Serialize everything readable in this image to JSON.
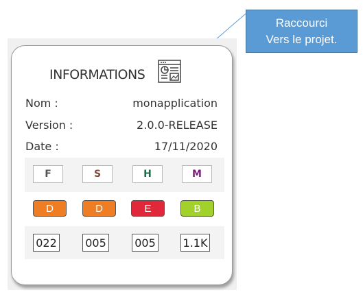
{
  "callout": {
    "line1": "Raccourci",
    "line2": "Vers le projet."
  },
  "card": {
    "title": "INFORMATIONS",
    "title_icon": "dashboard-report-icon",
    "info": [
      {
        "label": "Nom :",
        "value": "monapplication"
      },
      {
        "label": "Version :",
        "value": "2.0.0-RELEASE"
      },
      {
        "label": "Date :",
        "value": "17/11/2020"
      }
    ],
    "letters": [
      {
        "text": "F",
        "color": "#555555"
      },
      {
        "text": "S",
        "color": "#7a4a3a"
      },
      {
        "text": "H",
        "color": "#1d6b4a"
      },
      {
        "text": "M",
        "color": "#7b1a7a"
      }
    ],
    "grades": [
      {
        "text": "D",
        "color": "#ee7d24"
      },
      {
        "text": "D",
        "color": "#ee7d24"
      },
      {
        "text": "E",
        "color": "#e0283a"
      },
      {
        "text": "B",
        "color": "#a2d12b"
      }
    ],
    "counts": [
      "022",
      "005",
      "005",
      "1.1K"
    ]
  }
}
